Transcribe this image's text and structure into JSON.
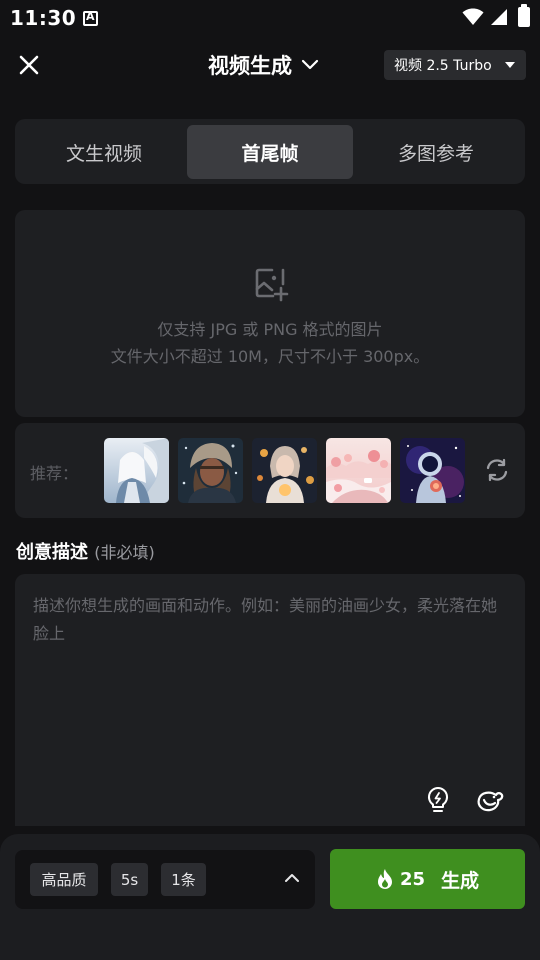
{
  "status_bar": {
    "time": "11:30"
  },
  "header": {
    "title": "视频生成",
    "model": "视频 2.5 Turbo"
  },
  "tabs": [
    {
      "label": "文生视频",
      "active": false
    },
    {
      "label": "首尾帧",
      "active": true
    },
    {
      "label": "多图参考",
      "active": false
    }
  ],
  "upload": {
    "hint_line1": "仅支持 JPG 或 PNG 格式的图片",
    "hint_line2": "文件大小不超过 10M，尺寸不小于 300px。"
  },
  "recommend": {
    "label": "推荐：",
    "thumbnails": [
      {
        "subject": "white-haired figure with dragon"
      },
      {
        "subject": "girl in fur hat in snow"
      },
      {
        "subject": "girl with glowing lanterns"
      },
      {
        "subject": "pink candy landscape"
      },
      {
        "subject": "astronaut in space"
      }
    ]
  },
  "prompt": {
    "heading": "创意描述",
    "optional": "(非必填)",
    "placeholder": "描述你想生成的画面和动作。例如：美丽的油画少女，柔光落在她脸上",
    "value": ""
  },
  "settings": {
    "quality": "高品质",
    "duration": "5s",
    "count": "1条"
  },
  "generate": {
    "cost": "25",
    "label": "生成"
  },
  "colors": {
    "background": "#121214",
    "card": "#1e1f22",
    "generate_button": "#3f8f1f",
    "active_tab": "#3b3c40"
  }
}
